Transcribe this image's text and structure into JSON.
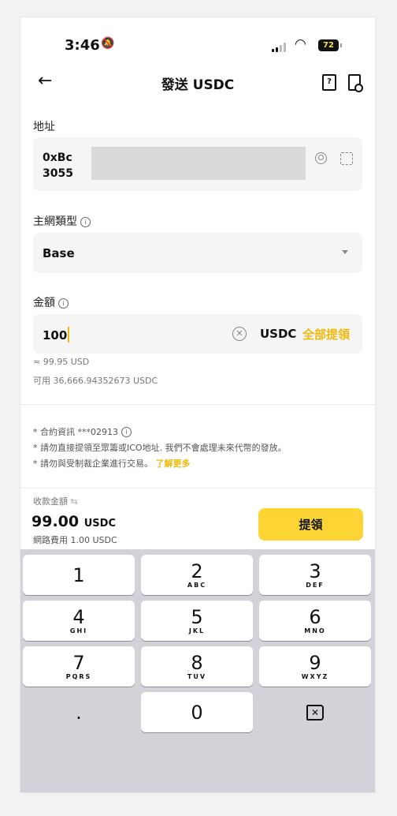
{
  "status_bar": {
    "time": "3:46",
    "battery": "72"
  },
  "header": {
    "title": "發送 USDC",
    "book_icon_char": "?"
  },
  "address": {
    "label": "地址",
    "line1": "0xBc",
    "line2": "3055"
  },
  "network": {
    "label": "主網類型",
    "value": "Base"
  },
  "amount": {
    "label": "金額",
    "value": "100",
    "unit": "USDC",
    "max_label": "全部提領",
    "approx": "≈ 99.95 USD",
    "available": "可用 36,666.94352673 USDC"
  },
  "notes": {
    "contract": "* 合約資訊 ***02913",
    "warning1": "* 請勿直接提領至眾籌或ICO地址. 我們不會處理未來代幣的發放。",
    "warning2": "* 請勿與受制裁企業進行交易。",
    "learn_more": "了解更多"
  },
  "summary": {
    "receive_label": "收款金額",
    "receive_amount": "99.00",
    "receive_unit": "USDC",
    "fee": "網路費用 1.00 USDC",
    "withdraw_button": "提領"
  },
  "keypad": [
    {
      "num": "1",
      "letters": ""
    },
    {
      "num": "2",
      "letters": "ABC"
    },
    {
      "num": "3",
      "letters": "DEF"
    },
    {
      "num": "4",
      "letters": "GHI"
    },
    {
      "num": "5",
      "letters": "JKL"
    },
    {
      "num": "6",
      "letters": "MNO"
    },
    {
      "num": "7",
      "letters": "PQRS"
    },
    {
      "num": "8",
      "letters": "TUV"
    },
    {
      "num": "9",
      "letters": "WXYZ"
    },
    {
      "num": ".",
      "letters": ""
    },
    {
      "num": "0",
      "letters": ""
    }
  ],
  "colors": {
    "accent": "#f0b90b",
    "button": "#fcd535",
    "field_bg": "#f5f5f5",
    "keypad_bg": "#d1d3d9"
  }
}
